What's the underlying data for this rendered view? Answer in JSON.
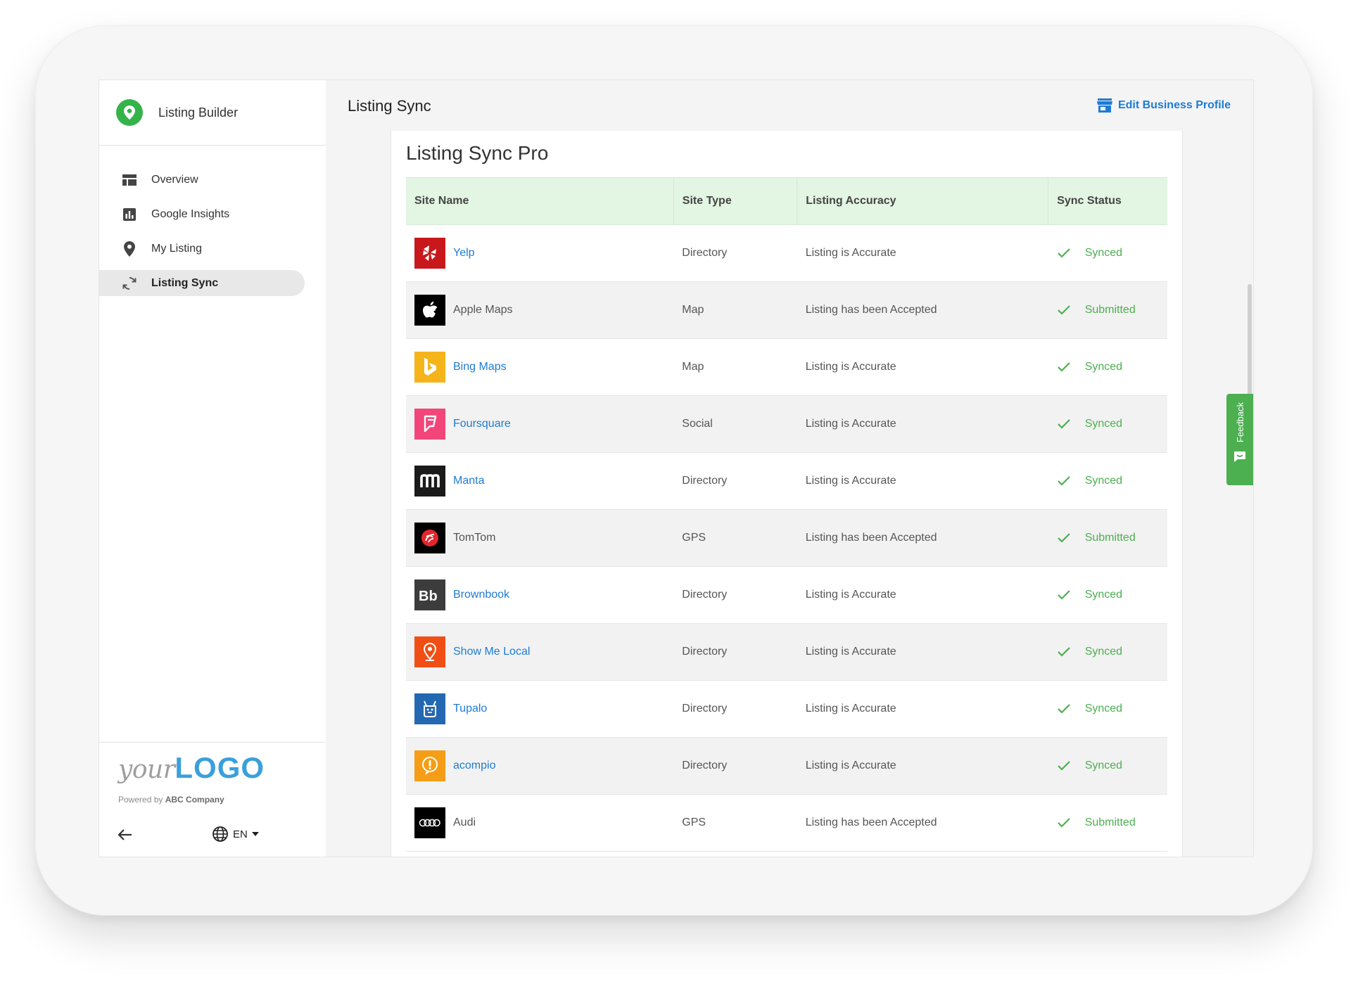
{
  "app": {
    "title": "Listing Builder"
  },
  "sidebar": {
    "items": [
      {
        "label": "Overview",
        "icon": "dashboard-icon",
        "active": false
      },
      {
        "label": "Google Insights",
        "icon": "bar-chart-icon",
        "active": false
      },
      {
        "label": "My Listing",
        "icon": "location-pin-icon",
        "active": false
      },
      {
        "label": "Listing Sync",
        "icon": "sync-icon",
        "active": true
      }
    ],
    "footer": {
      "logo_prefix": "your",
      "logo_main": "LOGO",
      "powered_by": "Powered by",
      "company": "ABC Company",
      "language": "EN"
    }
  },
  "header": {
    "title": "Listing Sync",
    "edit_profile": "Edit Business Profile"
  },
  "card": {
    "title": "Listing Sync Pro"
  },
  "table": {
    "columns": [
      "Site Name",
      "Site Type",
      "Listing Accuracy",
      "Sync Status"
    ],
    "rows": [
      {
        "site": "Yelp",
        "type": "Directory",
        "accuracy": "Listing is Accurate",
        "status": "Synced",
        "link": true,
        "icon_bg": "#c8181b"
      },
      {
        "site": "Apple Maps",
        "type": "Map",
        "accuracy": "Listing has been Accepted",
        "status": "Submitted",
        "link": false,
        "icon_bg": "#000000"
      },
      {
        "site": "Bing Maps",
        "type": "Map",
        "accuracy": "Listing is Accurate",
        "status": "Synced",
        "link": true,
        "icon_bg": "#f4b41a"
      },
      {
        "site": "Foursquare",
        "type": "Social",
        "accuracy": "Listing is Accurate",
        "status": "Synced",
        "link": true,
        "icon_bg": "#f2467a"
      },
      {
        "site": "Manta",
        "type": "Directory",
        "accuracy": "Listing is Accurate",
        "status": "Synced",
        "link": true,
        "icon_bg": "#1a1a1a"
      },
      {
        "site": "TomTom",
        "type": "GPS",
        "accuracy": "Listing has been Accepted",
        "status": "Submitted",
        "link": false,
        "icon_bg": "#000000"
      },
      {
        "site": "Brownbook",
        "type": "Directory",
        "accuracy": "Listing is Accurate",
        "status": "Synced",
        "link": true,
        "icon_bg": "#3c3c3c"
      },
      {
        "site": "Show Me Local",
        "type": "Directory",
        "accuracy": "Listing is Accurate",
        "status": "Synced",
        "link": true,
        "icon_bg": "#f04e14"
      },
      {
        "site": "Tupalo",
        "type": "Directory",
        "accuracy": "Listing is Accurate",
        "status": "Synced",
        "link": true,
        "icon_bg": "#2468b2"
      },
      {
        "site": "acompio",
        "type": "Directory",
        "accuracy": "Listing is Accurate",
        "status": "Synced",
        "link": true,
        "icon_bg": "#f59d16"
      },
      {
        "site": "Audi",
        "type": "GPS",
        "accuracy": "Listing has been Accepted",
        "status": "Submitted",
        "link": false,
        "icon_bg": "#000000"
      }
    ]
  },
  "feedback": {
    "label": "Feedback"
  },
  "colors": {
    "accent": "#1e7bd4",
    "success": "#4caf50",
    "header_green": "#e3f5e3"
  }
}
